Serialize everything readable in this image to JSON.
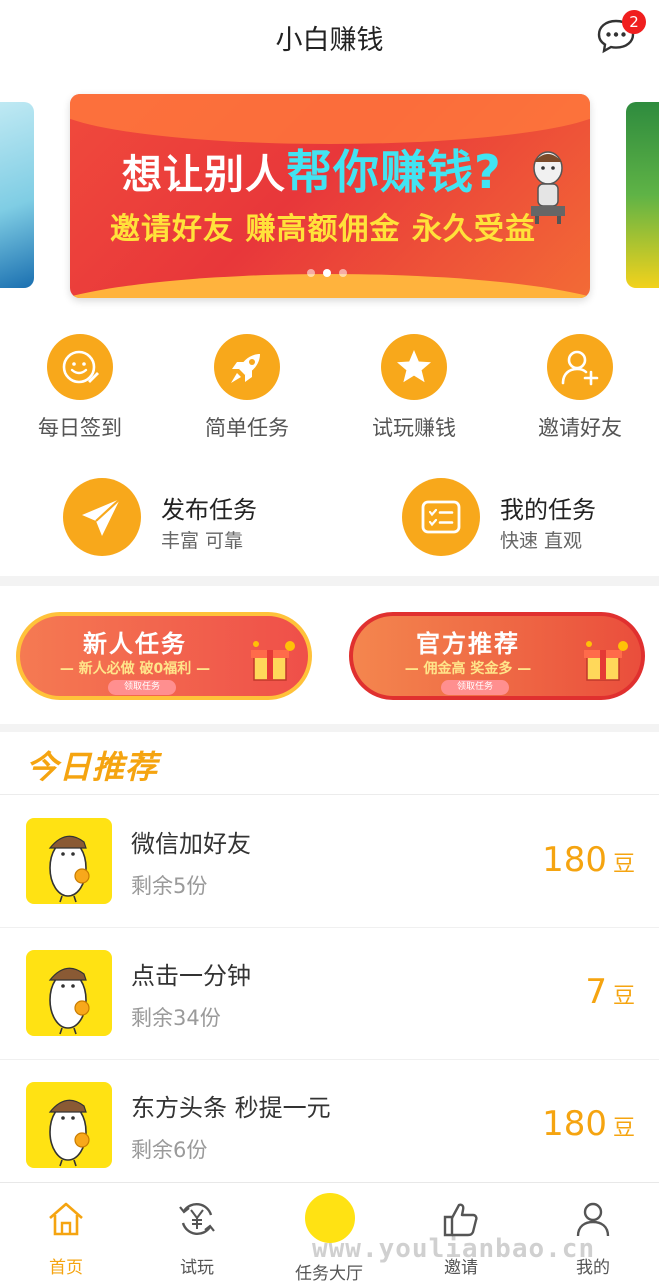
{
  "header": {
    "title": "小白赚钱",
    "message_badge": "2"
  },
  "banner": {
    "line1_prefix": "想让别人",
    "line1_highlight": "帮你赚钱?",
    "line2": "邀请好友 赚高额佣金 永久受益",
    "dots": 3,
    "active_dot": 1
  },
  "quick_actions": [
    {
      "label": "每日签到",
      "icon": "smile-pen-icon"
    },
    {
      "label": "简单任务",
      "icon": "rocket-icon"
    },
    {
      "label": "试玩赚钱",
      "icon": "star-icon"
    },
    {
      "label": "邀请好友",
      "icon": "add-user-icon"
    }
  ],
  "publish": {
    "title": "发布任务",
    "subtitle": "丰富 可靠"
  },
  "my_tasks": {
    "title": "我的任务",
    "subtitle": "快速 直观"
  },
  "pills": [
    {
      "title": "新人任务",
      "subtitle": "— 新人必做 破0福利 —",
      "button": "领取任务"
    },
    {
      "title": "官方推荐",
      "subtitle": "— 佣金高 奖金多 —",
      "button": "领取任务"
    }
  ],
  "recommend": {
    "title": "今日推荐",
    "tasks": [
      {
        "name": "微信加好友",
        "remaining": "剩余5份",
        "reward": "180",
        "unit": "豆"
      },
      {
        "name": "点击一分钟",
        "remaining": "剩余34份",
        "reward": "7",
        "unit": "豆"
      },
      {
        "name": "东方头条 秒提一元",
        "remaining": "剩余6份",
        "reward": "180",
        "unit": "豆"
      }
    ]
  },
  "nav": {
    "items": [
      {
        "label": "首页",
        "icon": "home-icon",
        "active": true
      },
      {
        "label": "试玩",
        "icon": "yen-refresh-icon",
        "active": false
      },
      {
        "label": "任务大厅",
        "icon": "mascot-icon",
        "active": false
      },
      {
        "label": "邀请",
        "icon": "thumbs-up-icon",
        "active": false
      },
      {
        "label": "我的",
        "icon": "user-icon",
        "active": false
      }
    ]
  },
  "watermark": "www.youlianbao.cn",
  "colors": {
    "accent": "#f8a81b",
    "reward": "#f5a410",
    "badge": "#f01f1f",
    "mascot_bg": "#ffe213"
  }
}
